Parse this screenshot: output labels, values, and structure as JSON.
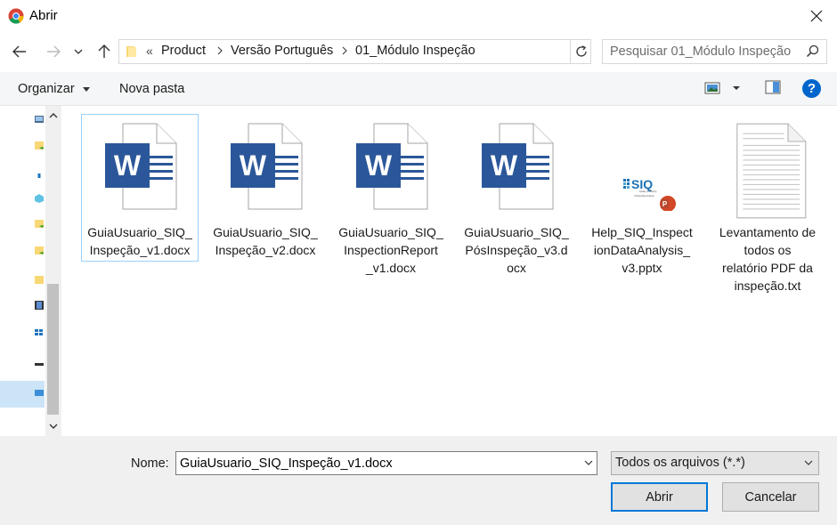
{
  "window": {
    "title": "Abrir",
    "app_icon": "chrome-icon",
    "close_icon": "close-icon"
  },
  "nav": {
    "back_icon": "back-arrow-icon",
    "forward_icon": "forward-arrow-icon",
    "recent_icon": "chevron-down-icon",
    "up_icon": "up-arrow-icon"
  },
  "address": {
    "overflow": "«",
    "crumbs": [
      "Product",
      "Versão Português",
      "01_Módulo Inspeção"
    ],
    "refresh_icon": "refresh-icon"
  },
  "search": {
    "placeholder": "Pesquisar 01_Módulo Inspeção",
    "icon": "search-icon"
  },
  "toolbar": {
    "organize_label": "Organizar",
    "new_folder_label": "Nova pasta",
    "view_icon": "view-options-icon",
    "preview_icon": "preview-pane-icon",
    "help_label": "?"
  },
  "files": [
    {
      "name": "GuiaUsuario_SIQ_Inspeção_v1.docx",
      "type": "word",
      "selected": true
    },
    {
      "name": "GuiaUsuario_SIQ_Inspeção_v2.docx",
      "type": "word",
      "selected": false
    },
    {
      "name": "GuiaUsuario_SIQ_InspectionReport_v1.docx",
      "type": "word",
      "selected": false
    },
    {
      "name": "GuiaUsuario_SIQ_PósInspeção_v3.docx",
      "type": "word",
      "selected": false
    },
    {
      "name": "Help_SIQ_InspectionDataAnalysis_v3.pptx",
      "type": "powerpoint",
      "selected": false
    },
    {
      "name": "Levantamento de todos os relatório PDF da inspeção.txt",
      "type": "text",
      "selected": false
    }
  ],
  "file_labels": [
    "GuiaUsuario_SIQ_\nInspeção_v1.docx",
    "GuiaUsuario_SIQ_\nInspeção_v2.docx",
    "GuiaUsuario_SIQ_\nInspectionReport\n_v1.docx",
    "GuiaUsuario_SIQ_\nPósInspeção_v3.d\nocx",
    "Help_SIQ_Inspect\nionDataAnalysis_\nv3.pptx",
    "Levantamento de\ntodos os\nrelatório PDF da\ninspeção.txt"
  ],
  "thumb_text": {
    "word_letter": "W",
    "siq_logo": "SIQ",
    "siq_tagline": "Quality philosophy",
    "siq_subtitle": "Tooling Data Analysis",
    "ppt_letter": "P"
  },
  "footer": {
    "name_label": "Nome:",
    "name_value": "GuiaUsuario_SIQ_Inspeção_v1.docx",
    "type_value": "Todos os arquivos (*.*)",
    "open_label": "Abrir",
    "cancel_label": "Cancelar"
  },
  "colors": {
    "accent": "#0078d7",
    "word_blue": "#2b579a",
    "ppt_orange": "#d24726",
    "selection": "#cce4f7"
  }
}
